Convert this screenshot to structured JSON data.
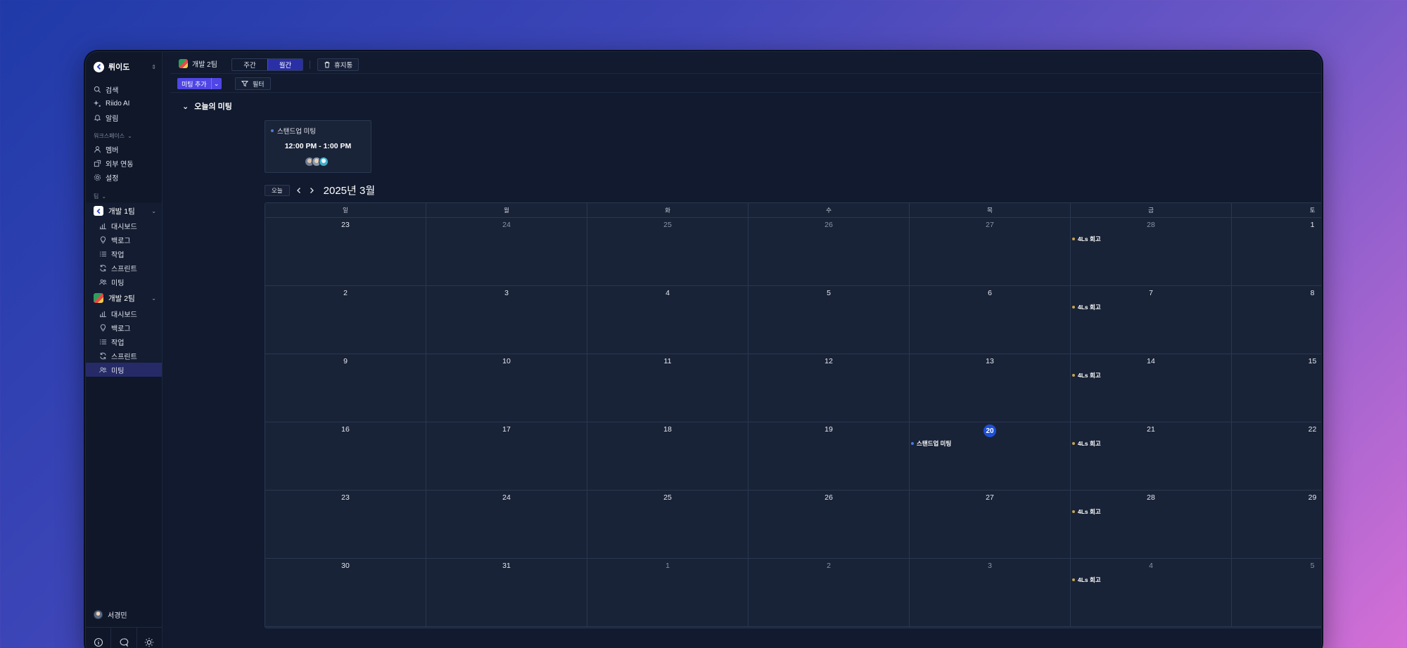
{
  "workspace": {
    "name": "뤼이도"
  },
  "sidebar": {
    "search": "검색",
    "ai": "Riido AI",
    "notifications": "알림",
    "workspace_section": "워크스페이스",
    "members": "멤버",
    "integrations": "외부 연동",
    "settings": "설정",
    "team_section": "팀",
    "team1": {
      "name": "개발 1팀",
      "items": [
        "대시보드",
        "백로그",
        "작업",
        "스프린트",
        "미팅"
      ]
    },
    "team2": {
      "name": "개발 2팀",
      "items": [
        "대시보드",
        "백로그",
        "작업",
        "스프린트",
        "미팅"
      ]
    },
    "user": "서경민"
  },
  "topbar": {
    "team": "개발 2팀",
    "view_weekly": "주간",
    "view_monthly": "월간",
    "trash": "휴지통"
  },
  "toolbar": {
    "add_meeting": "미팅 추가",
    "filter": "필터"
  },
  "today_meetings": {
    "heading": "오늘의 미팅",
    "card": {
      "title": "스탠드업 미팅",
      "time": "12:00 PM - 1:00 PM"
    }
  },
  "calendar": {
    "today_button": "오늘",
    "month_title": "2025년 3월",
    "weekdays": [
      "일",
      "월",
      "화",
      "수",
      "목",
      "금",
      "토"
    ],
    "days": [
      {
        "n": "23",
        "muted": false
      },
      {
        "n": "24",
        "muted": true
      },
      {
        "n": "25",
        "muted": true
      },
      {
        "n": "26",
        "muted": true
      },
      {
        "n": "27",
        "muted": true
      },
      {
        "n": "28",
        "muted": true,
        "event": "4Ls 회고",
        "color": "#c9a24a"
      },
      {
        "n": "1",
        "muted": false
      },
      {
        "n": "2",
        "muted": false
      },
      {
        "n": "3",
        "muted": false
      },
      {
        "n": "4",
        "muted": false
      },
      {
        "n": "5",
        "muted": false
      },
      {
        "n": "6",
        "muted": false
      },
      {
        "n": "7",
        "muted": false,
        "event": "4Ls 회고",
        "color": "#c9a24a"
      },
      {
        "n": "8",
        "muted": false
      },
      {
        "n": "9",
        "muted": false
      },
      {
        "n": "10",
        "muted": false
      },
      {
        "n": "11",
        "muted": false
      },
      {
        "n": "12",
        "muted": false
      },
      {
        "n": "13",
        "muted": false
      },
      {
        "n": "14",
        "muted": false,
        "event": "4Ls 회고",
        "color": "#c9a24a"
      },
      {
        "n": "15",
        "muted": false
      },
      {
        "n": "16",
        "muted": false
      },
      {
        "n": "17",
        "muted": false
      },
      {
        "n": "18",
        "muted": false
      },
      {
        "n": "19",
        "muted": false
      },
      {
        "n": "20",
        "muted": false,
        "today": true,
        "event": "스탠드업 미팅",
        "color": "#4a7be0"
      },
      {
        "n": "21",
        "muted": false,
        "event": "4Ls 회고",
        "color": "#c9a24a"
      },
      {
        "n": "22",
        "muted": false
      },
      {
        "n": "23",
        "muted": false
      },
      {
        "n": "24",
        "muted": false
      },
      {
        "n": "25",
        "muted": false
      },
      {
        "n": "26",
        "muted": false
      },
      {
        "n": "27",
        "muted": false
      },
      {
        "n": "28",
        "muted": false,
        "event": "4Ls 회고",
        "color": "#c9a24a"
      },
      {
        "n": "29",
        "muted": false
      },
      {
        "n": "30",
        "muted": false
      },
      {
        "n": "31",
        "muted": false
      },
      {
        "n": "1",
        "muted": true
      },
      {
        "n": "2",
        "muted": true
      },
      {
        "n": "3",
        "muted": true
      },
      {
        "n": "4",
        "muted": true,
        "event": "4Ls 회고",
        "color": "#c9a24a"
      },
      {
        "n": "5",
        "muted": true
      }
    ]
  },
  "colors": {
    "accent": "#4f46e5",
    "today": "#1d4fd8",
    "retro_dot": "#c9a24a",
    "standup_dot": "#4a7be0"
  }
}
